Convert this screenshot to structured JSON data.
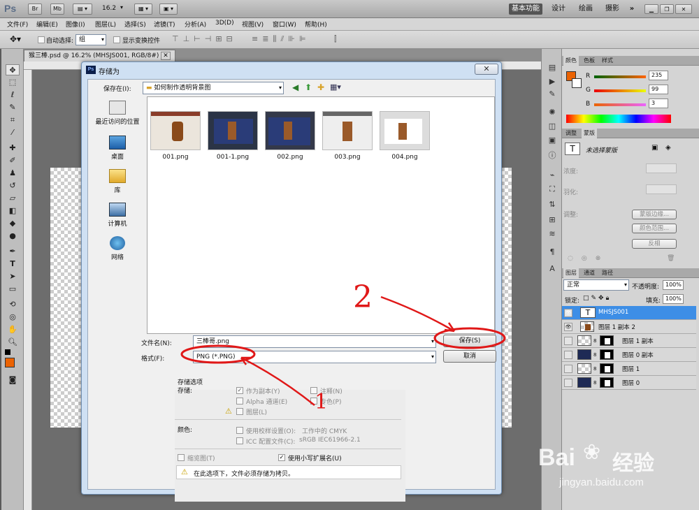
{
  "app": {
    "logo": "Ps",
    "mini_buttons": [
      "Br",
      "Mb"
    ],
    "zoom": "16.2",
    "workspaces": [
      {
        "label": "基本功能",
        "active": true
      },
      {
        "label": "设计",
        "active": false
      },
      {
        "label": "绘画",
        "active": false
      },
      {
        "label": "摄影",
        "active": false
      },
      {
        "label": "»",
        "active": false
      }
    ]
  },
  "menu": [
    "文件(F)",
    "编辑(E)",
    "图像(I)",
    "图层(L)",
    "选择(S)",
    "滤镜(T)",
    "分析(A)",
    "3D(D)",
    "视图(V)",
    "窗口(W)",
    "帮助(H)"
  ],
  "options_bar": {
    "auto_select_label": "自动选择:",
    "auto_select_value": "组",
    "show_transform_label": "显示变换控件"
  },
  "document": {
    "tab_label": "猴三棒.psd @ 16.2% (MHSJS001, RGB/8#)"
  },
  "panels": {
    "color": {
      "tabs": [
        "颜色",
        "色板",
        "样式"
      ],
      "r_label": "R",
      "g_label": "G",
      "b_label": "B",
      "r": "235",
      "g": "99",
      "b": "3",
      "foreground": "#eb6303"
    },
    "masks": {
      "tabs": [
        "调整",
        "蒙版"
      ],
      "status": "未选择蒙版",
      "density_label": "浓度:",
      "feather_label": "羽化:",
      "refine_label": "调整:",
      "buttons": [
        "蒙版边缘...",
        "颜色范围...",
        "反相"
      ]
    },
    "layers": {
      "tabs": [
        "图层",
        "通道",
        "路径"
      ],
      "blend_mode": "正常",
      "opacity_label": "不透明度:",
      "opacity": "100%",
      "lock_label": "锁定:",
      "fill_label": "填充:",
      "fill": "100%",
      "items": [
        {
          "name": "MHSJS001",
          "type": "text",
          "selected": true,
          "visible": true
        },
        {
          "name": "图层 1 副本 2",
          "type": "image",
          "selected": false,
          "visible": true
        },
        {
          "name": "图层 1 副本",
          "type": "masked",
          "selected": false,
          "visible": false
        },
        {
          "name": "图层 0 副本",
          "type": "masked",
          "selected": false,
          "visible": false
        },
        {
          "name": "图层 1",
          "type": "masked",
          "selected": false,
          "visible": false
        },
        {
          "name": "图层 0",
          "type": "masked",
          "selected": false,
          "visible": false
        }
      ]
    }
  },
  "dialog": {
    "title": "存储为",
    "save_in_label": "保存在(I):",
    "save_in_value": "如何制作透明背景图",
    "places": [
      "最近访问的位置",
      "桌面",
      "库",
      "计算机",
      "网络"
    ],
    "files": [
      "001.png",
      "001-1.png",
      "002.png",
      "003.png",
      "004.png"
    ],
    "filename_label": "文件名(N):",
    "filename_value": "三棒哥.png",
    "format_label": "格式(F):",
    "format_value": "PNG (*.PNG)",
    "save_button": "保存(S)",
    "cancel_button": "取消",
    "options": {
      "group_title": "存储选项",
      "store_label": "存储:",
      "as_copy": "作为副本(Y)",
      "notes": "注释(N)",
      "alpha": "Alpha 通道(E)",
      "spot": "专色(P)",
      "layers": "图层(L)",
      "color_label": "颜色:",
      "use_proof": "使用校样设置(O):",
      "proof_value": "工作中的 CMYK",
      "icc": "ICC 配置文件(C):",
      "icc_value": "sRGB IEC61966-2.1",
      "thumbnail": "缩览图(T)",
      "lowercase": "使用小写扩展名(U)",
      "warning": "在此选项下，文件必须存储为拷贝。"
    }
  },
  "annotations": {
    "number_1": "1",
    "number_2": "2",
    "color": "#e01818"
  },
  "watermark": {
    "brand": "Bai",
    "brand2": "经验",
    "url": "jingyan.baidu.com"
  }
}
